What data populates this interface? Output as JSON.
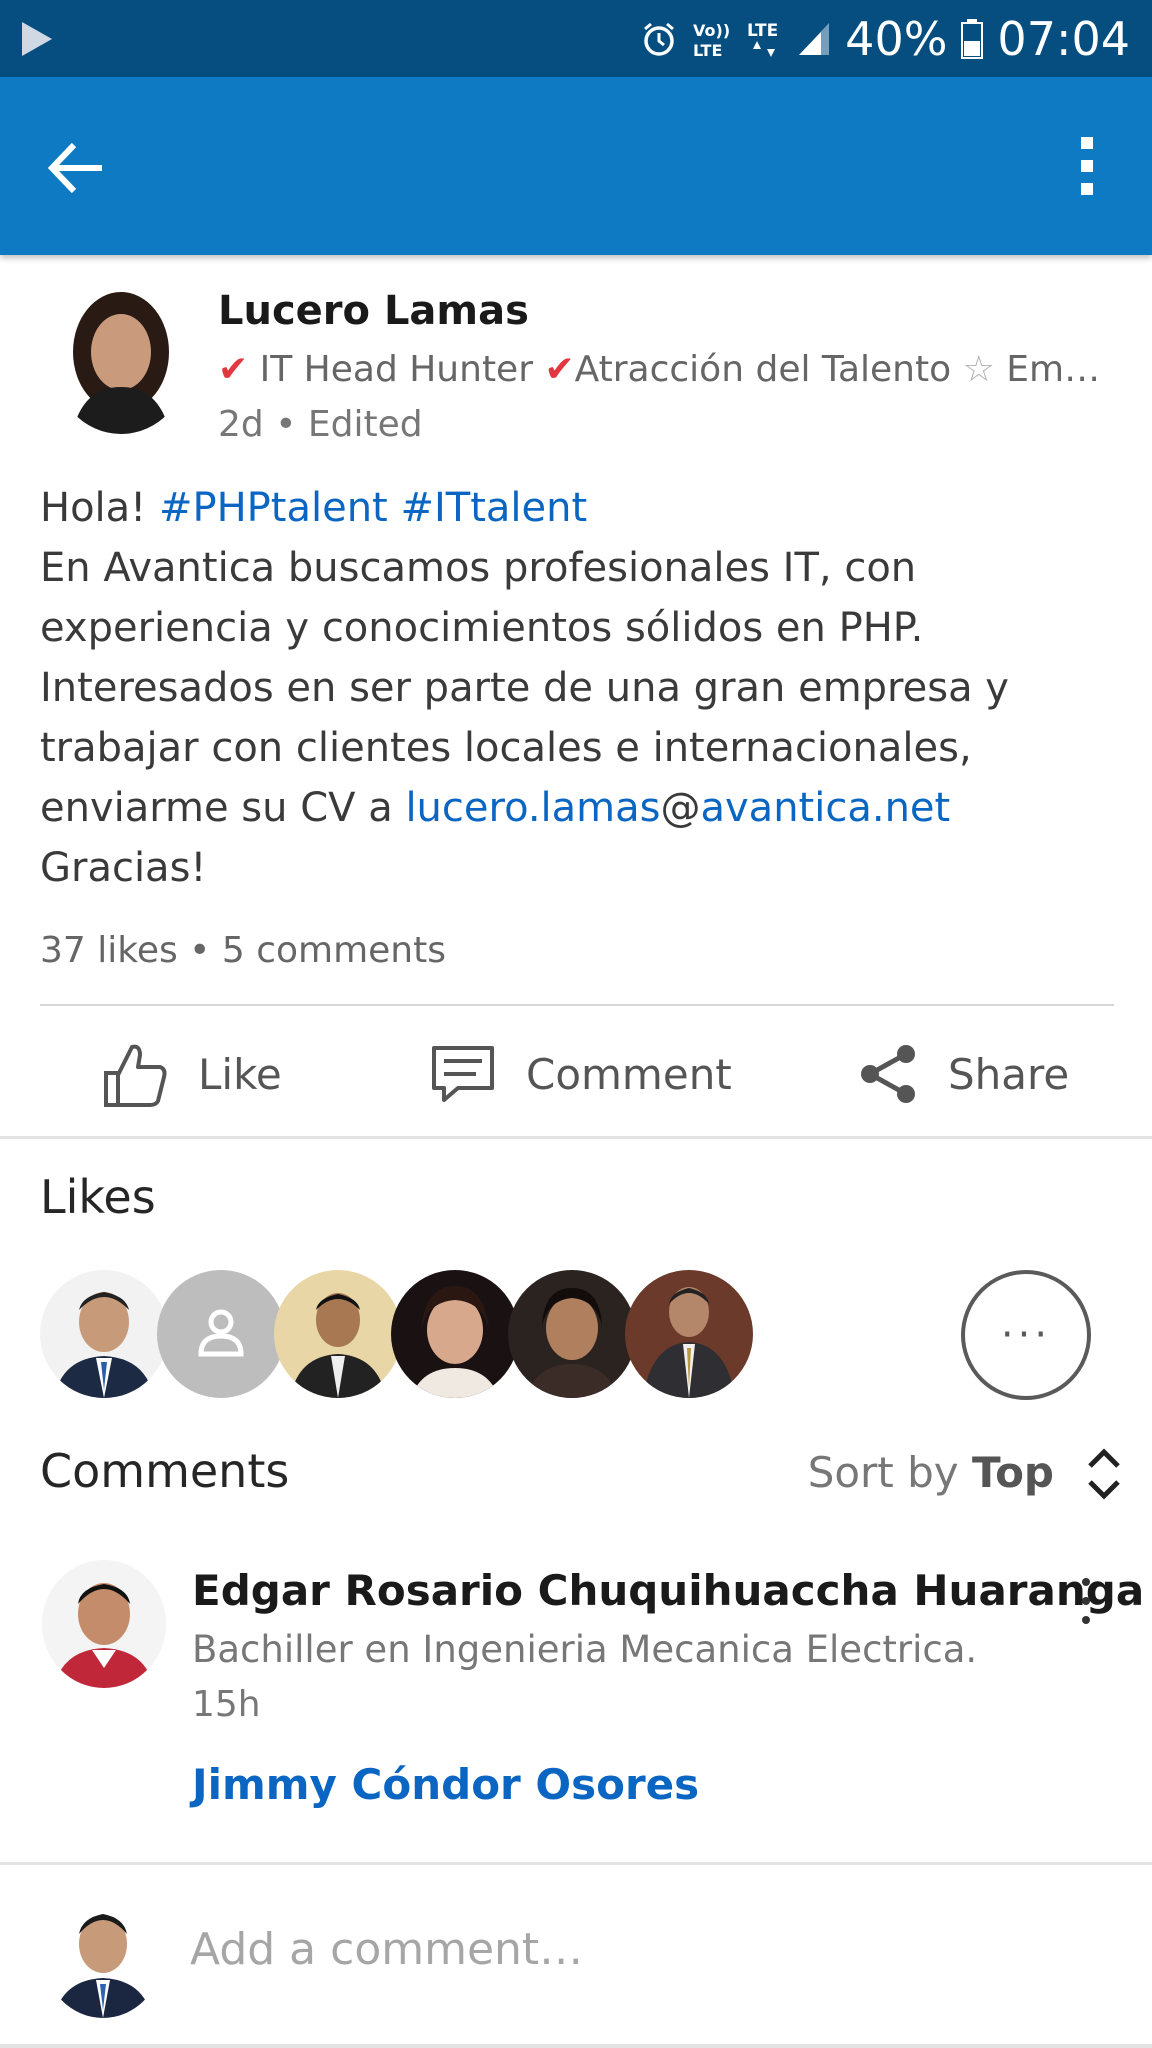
{
  "status_bar": {
    "battery": "40%",
    "time": "07:04",
    "network": "LTE",
    "volte": "Vo)) LTE",
    "icons": [
      "play-icon",
      "alarm-icon",
      "volte-icon",
      "lte-icon",
      "signal-icon",
      "battery-icon"
    ]
  },
  "app_bar": {
    "icons": [
      "back-arrow-icon",
      "more-vert-icon"
    ]
  },
  "post": {
    "author": "Lucero Lamas",
    "headline_parts": [
      "✔",
      " IT Head Hunter ",
      "✔",
      "Atracción del Talento ",
      "☆",
      " Em…"
    ],
    "meta": "2d • Edited",
    "greeting": "Hola! ",
    "hashtags": [
      "#PHPtalent",
      "#ITtalent"
    ],
    "lines": [
      "En Avantica buscamos profesionales IT, con",
      "experiencia y conocimientos sólidos en PHP.",
      "Interesados en ser parte de una gran empresa y",
      "trabajar con clientes locales e internacionales,"
    ],
    "cv_prefix": "enviarme su CV a ",
    "email_user": "lucero.lamas",
    "email_at": "@",
    "email_domain": "avantica.net",
    "closing": "Gracias!",
    "counts": "37 likes • 5 comments"
  },
  "actions": {
    "like": "Like",
    "comment": "Comment",
    "share": "Share"
  },
  "likes_section": {
    "title": "Likes",
    "more": "···"
  },
  "comments_section": {
    "title": "Comments",
    "sort_prefix": "Sort by ",
    "sort_value": "Top"
  },
  "comment": {
    "author": "Edgar Rosario Chuquihuaccha Huaranga",
    "headline": "Bachiller en Ingenieria Mecanica Electrica.",
    "time": "15h",
    "text": "Jimmy Cóndor Osores"
  },
  "composer": {
    "placeholder": "Add a comment…"
  },
  "colors": {
    "status_bar": "#064e80",
    "app_bar": "#0e7ac4",
    "link": "#0a66c2",
    "check": "#e0383e"
  }
}
